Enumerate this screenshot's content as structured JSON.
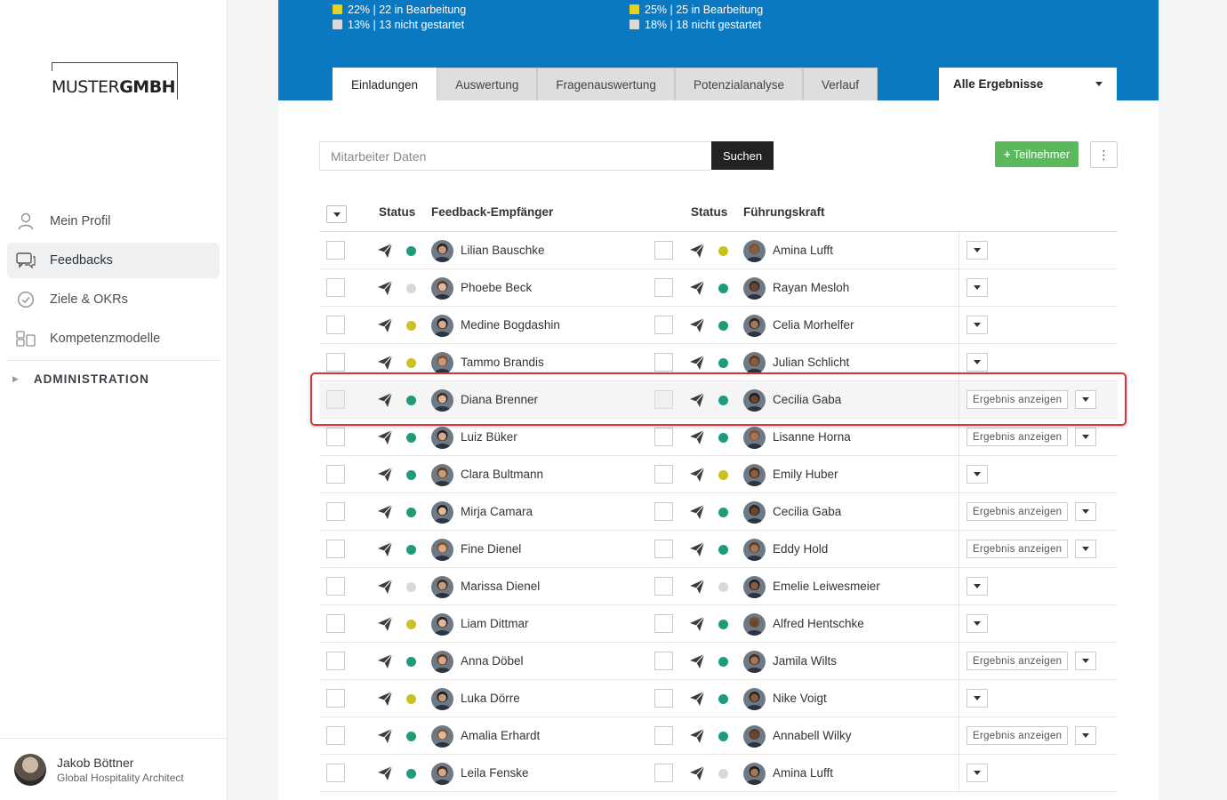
{
  "brand": {
    "logo_light": "MUSTER",
    "logo_bold": "GMBH"
  },
  "sidebar": {
    "items": [
      {
        "label": "Mein Profil",
        "icon": "user-icon",
        "active": false
      },
      {
        "label": "Feedbacks",
        "icon": "chat-icon",
        "active": true
      },
      {
        "label": "Ziele & OKRs",
        "icon": "check-circle-icon",
        "active": false
      },
      {
        "label": "Kompetenzmodelle",
        "icon": "grid-icon",
        "active": false
      }
    ],
    "admin_label": "ADMINISTRATION"
  },
  "user": {
    "name": "Jakob Böttner",
    "role": "Global Hospitality Architect"
  },
  "stats": {
    "left": [
      {
        "color": "yellow",
        "text": "22% | 22 in Bearbeitung"
      },
      {
        "color": "grey",
        "text": "13% | 13 nicht gestartet"
      }
    ],
    "right": [
      {
        "color": "yellow",
        "text": "25% | 25 in Bearbeitung"
      },
      {
        "color": "grey",
        "text": "18% | 18 nicht gestartet"
      }
    ]
  },
  "tabs": [
    "Einladungen",
    "Auswertung",
    "Fragenauswertung",
    "Potenzialanalyse",
    "Verlauf"
  ],
  "active_tab": "Einladungen",
  "filter": {
    "selected": "Alle Ergebnisse"
  },
  "search": {
    "placeholder": "Mitarbeiter Daten",
    "button": "Suchen"
  },
  "add_button": "Teilnehmer",
  "table": {
    "headers": {
      "status1": "Status",
      "recipient": "Feedback-Empfänger",
      "status2": "Status",
      "manager": "Führungskraft"
    },
    "result_button": "Ergebnis anzeigen",
    "rows": [
      {
        "s1": "green",
        "name": "Lilian Bauschke",
        "s2": "yellow",
        "manager": "Amina Lufft",
        "result": false
      },
      {
        "s1": "grey",
        "name": "Phoebe Beck",
        "s2": "green",
        "manager": "Rayan Mesloh",
        "result": false
      },
      {
        "s1": "yellow",
        "name": "Medine Bogdashin",
        "s2": "green",
        "manager": "Celia Morhelfer",
        "result": false
      },
      {
        "s1": "yellow",
        "name": "Tammo Brandis",
        "s2": "green",
        "manager": "Julian Schlicht",
        "result": false
      },
      {
        "s1": "green",
        "name": "Diana Brenner",
        "s2": "green",
        "manager": "Cecilia Gaba",
        "result": true,
        "highlight": true
      },
      {
        "s1": "green",
        "name": "Luiz Büker",
        "s2": "green",
        "manager": "Lisanne Horna",
        "result": true
      },
      {
        "s1": "green",
        "name": "Clara Bultmann",
        "s2": "yellow",
        "manager": "Emily Huber",
        "result": false
      },
      {
        "s1": "green",
        "name": "Mirja Camara",
        "s2": "green",
        "manager": "Cecilia Gaba",
        "result": true
      },
      {
        "s1": "green",
        "name": "Fine Dienel",
        "s2": "green",
        "manager": "Eddy Hold",
        "result": true
      },
      {
        "s1": "grey",
        "name": "Marissa Dienel",
        "s2": "grey",
        "manager": "Emelie Leiwesmeier",
        "result": false
      },
      {
        "s1": "yellow",
        "name": "Liam Dittmar",
        "s2": "green",
        "manager": "Alfred Hentschke",
        "result": false
      },
      {
        "s1": "green",
        "name": "Anna Döbel",
        "s2": "green",
        "manager": "Jamila Wilts",
        "result": true
      },
      {
        "s1": "yellow",
        "name": "Luka Dörre",
        "s2": "green",
        "manager": "Nike Voigt",
        "result": false
      },
      {
        "s1": "green",
        "name": "Amalia Erhardt",
        "s2": "green",
        "manager": "Annabell Wilky",
        "result": true
      },
      {
        "s1": "green",
        "name": "Leila Fenske",
        "s2": "grey",
        "manager": "Amina Lufft",
        "result": false
      }
    ]
  },
  "colors": {
    "banner": "#0a79c2",
    "green": "#1e9b7c",
    "yellow": "#ccc11c",
    "grey": "#d9d9d9",
    "add": "#5cb85c",
    "highlight": "#d9343a"
  }
}
